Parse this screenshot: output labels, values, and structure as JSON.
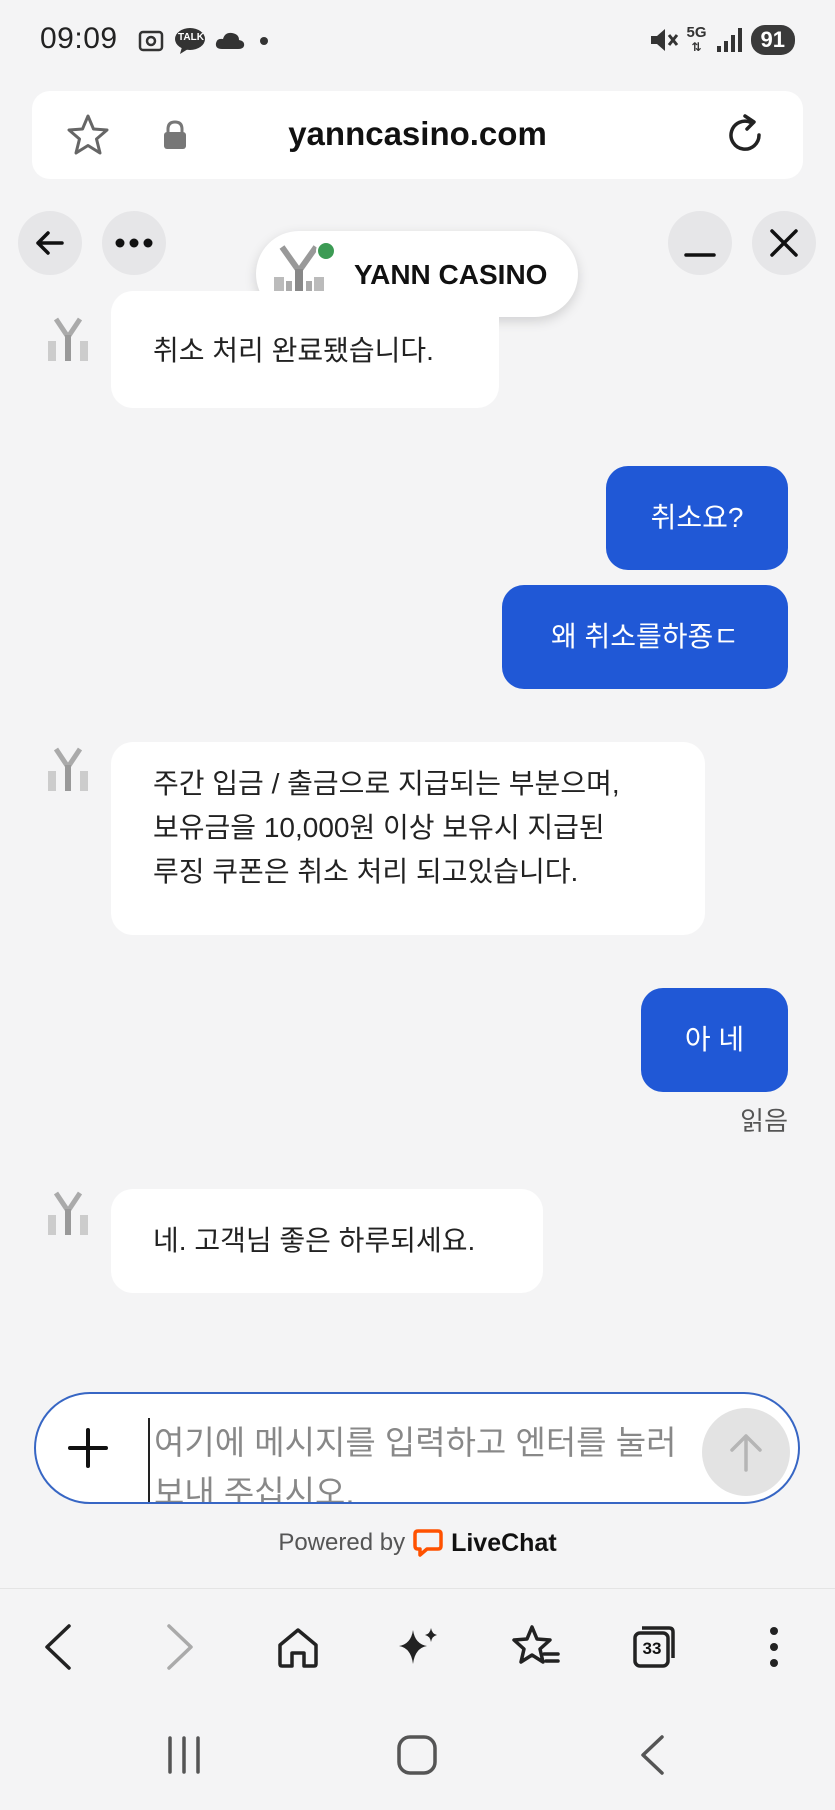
{
  "status": {
    "time": "09:09",
    "talk_badge": "TALK",
    "network": "5G",
    "battery": "91"
  },
  "url_bar": {
    "url": "yanncasino.com"
  },
  "chat": {
    "agent_name": "YANN CASINO",
    "messages": [
      {
        "from": "agent",
        "text": "취소 처리 완료됐습니다."
      },
      {
        "from": "user",
        "text": "취소요?"
      },
      {
        "from": "user",
        "text": "왜 취소를하죵ㄷ"
      },
      {
        "from": "agent",
        "lines": [
          "주간 입금 / 출금으로 지급되는 부분으며,",
          "보유금을 10,000원 이상 보유시 지급된",
          "루징 쿠폰은 취소 처리 되고있습니다."
        ]
      },
      {
        "from": "user",
        "text": "아 네"
      },
      {
        "from": "agent",
        "text": "네. 고객님 좋은 하루되세요."
      }
    ],
    "read_label": "읽음",
    "input_placeholder": "여기에 메시지를 입력하고 엔터를 눌러 보내 주십시오.",
    "powered_by": "Powered by",
    "powered_brand": "LiveChat"
  },
  "toolbar": {
    "tabs_count": "33"
  },
  "colors": {
    "user_bubble": "#2058d6",
    "online": "#3c9b54",
    "livechat_orange": "#ff5100"
  }
}
